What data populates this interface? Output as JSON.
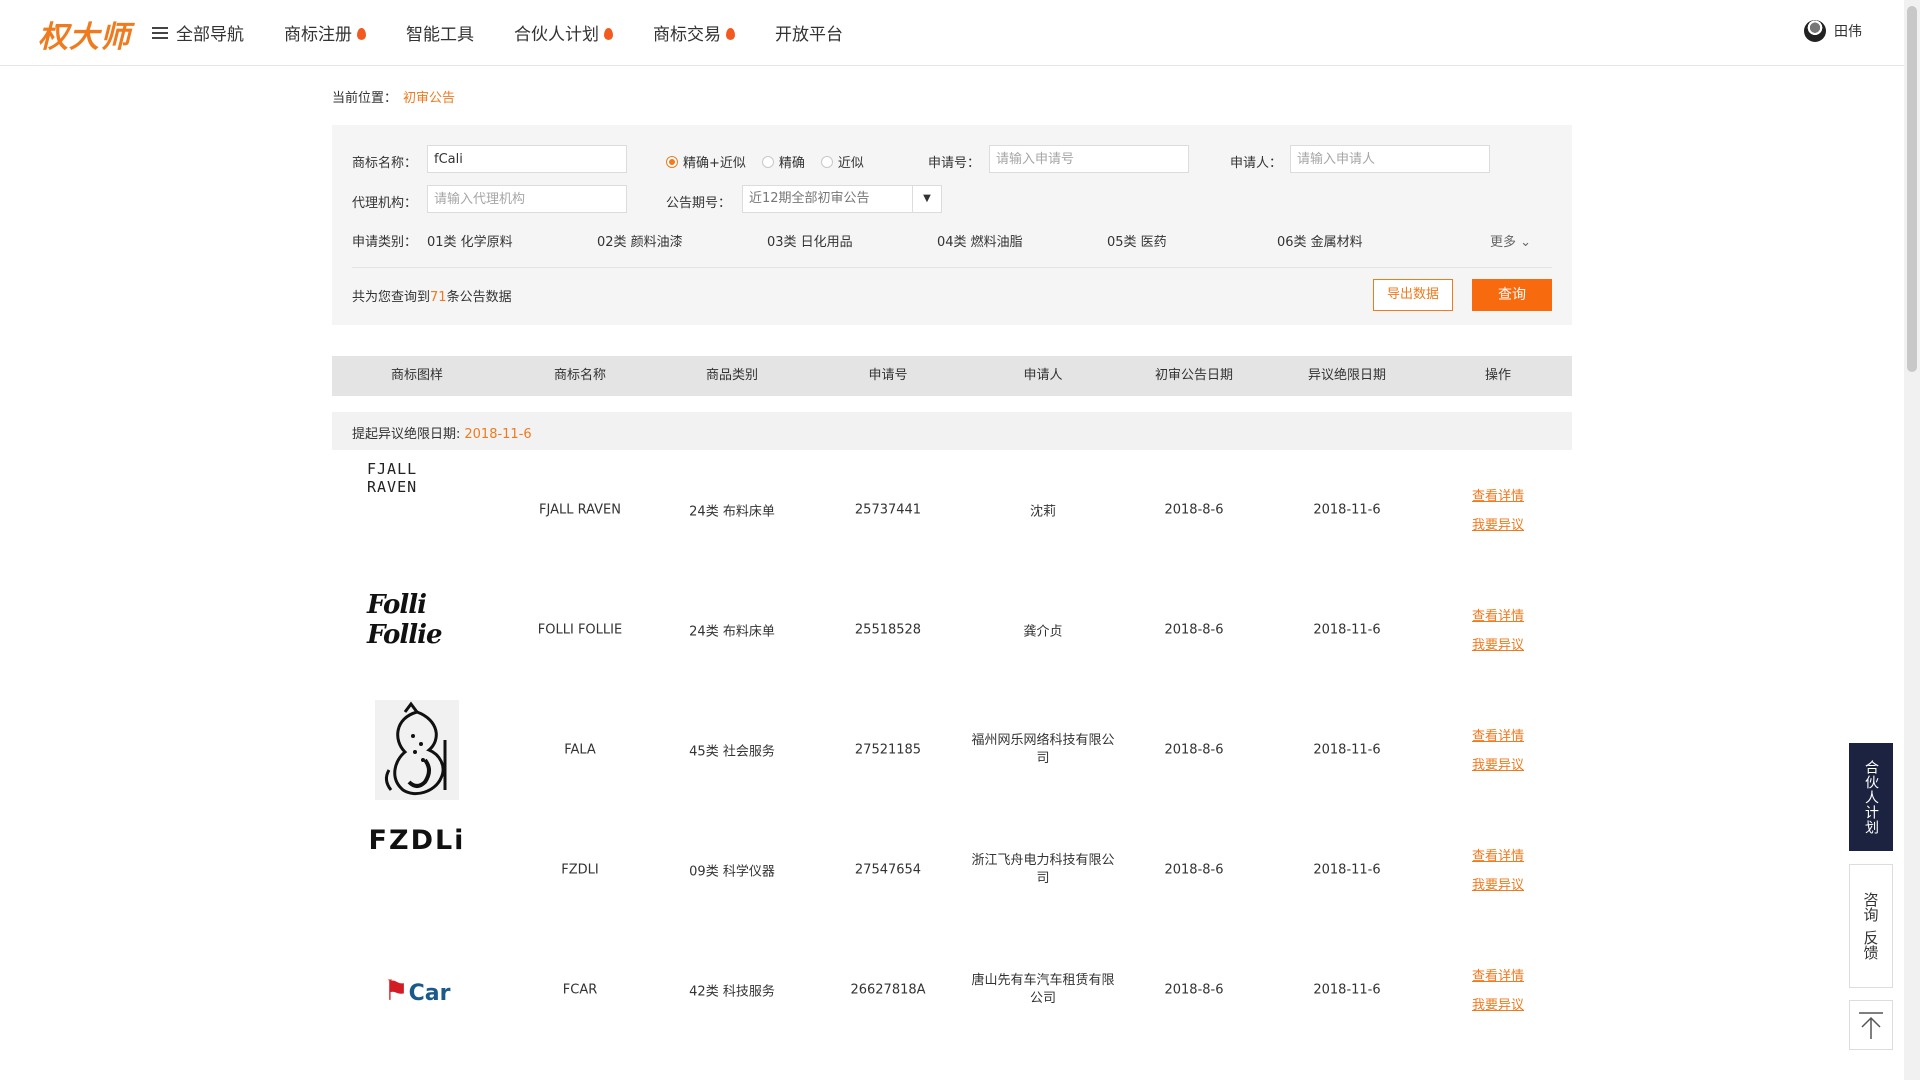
{
  "brand": {
    "logo_text": "权大师"
  },
  "nav": {
    "all_nav": "全部导航",
    "items": [
      {
        "label": "商标注册",
        "hot": true
      },
      {
        "label": "智能工具",
        "hot": false
      },
      {
        "label": "合伙人计划",
        "hot": true
      },
      {
        "label": "商标交易",
        "hot": true
      },
      {
        "label": "开放平台",
        "hot": false
      }
    ]
  },
  "user": {
    "name": "田伟"
  },
  "breadcrumb": {
    "prefix": "当前位置：",
    "current": "初审公告"
  },
  "search": {
    "trademark_label": "商标名称：",
    "trademark_value": "fCali",
    "match_options": [
      "精确+近似",
      "精确",
      "近似"
    ],
    "match_selected": "精确+近似",
    "appno_label": "申请号：",
    "appno_placeholder": "请输入申请号",
    "applicant_label": "申请人：",
    "applicant_placeholder": "请输入申请人",
    "agency_label": "代理机构：",
    "agency_placeholder": "请输入代理机构",
    "issue_label": "公告期号：",
    "issue_value": "近12期全部初审公告",
    "category_label": "申请类别：",
    "categories": [
      "01类 化学原料",
      "02类 颜料油漆",
      "03类 日化用品",
      "04类 燃料油脂",
      "05类 医药",
      "06类 金属材料"
    ],
    "more_label": "更多 ⌄",
    "count_prefix": "共为您查询到",
    "count_value": "71",
    "count_suffix": "条公告数据",
    "export_label": "导出数据",
    "query_label": "查询"
  },
  "table": {
    "headers": [
      "商标图样",
      "商标名称",
      "商品类别",
      "申请号",
      "申请人",
      "初审公告日期",
      "异议绝限日期",
      "操作"
    ],
    "group_label": "提起异议绝限日期:",
    "group_date": "2018-11-6",
    "rows": [
      {
        "logo": "FJALL RAVEN",
        "name": "FJALL RAVEN",
        "category": "24类 布料床单",
        "appno": "25737441",
        "applicant": "沈莉",
        "pub_date": "2018-8-6",
        "deadline": "2018-11-6"
      },
      {
        "logo": "Folli Follie",
        "name": "FOLLI FOLLIE",
        "category": "24类 布料床单",
        "appno": "25518528",
        "applicant": "龚介贞",
        "pub_date": "2018-8-6",
        "deadline": "2018-11-6"
      },
      {
        "logo": "",
        "name": "FALA",
        "category": "45类 社会服务",
        "appno": "27521185",
        "applicant": "福州网乐网络科技有限公司",
        "pub_date": "2018-8-6",
        "deadline": "2018-11-6"
      },
      {
        "logo": "FZDLi",
        "name": "FZDLI",
        "category": "09类 科学仪器",
        "appno": "27547654",
        "applicant": "浙江飞舟电力科技有限公司",
        "pub_date": "2018-8-6",
        "deadline": "2018-11-6"
      },
      {
        "logo": "Car",
        "name": "FCAR",
        "category": "42类 科技服务",
        "appno": "26627818A",
        "applicant": "唐山先有车汽车租赁有限公司",
        "pub_date": "2018-8-6",
        "deadline": "2018-11-6"
      }
    ],
    "detail_label": "查看详情",
    "object_label": "我要异议"
  },
  "side": {
    "partner": "合伙人计划",
    "consult": "咨询",
    "feedback": "反馈"
  },
  "colors": {
    "accent": "#f07a1e",
    "primary_button": "#f86a0e",
    "side_dark": "#1b2340"
  },
  "icons": [
    "menu-icon",
    "flame-icon",
    "avatar",
    "radio-icon",
    "dropdown-arrow-icon",
    "chevron-down-icon",
    "back-to-top-icon"
  ]
}
